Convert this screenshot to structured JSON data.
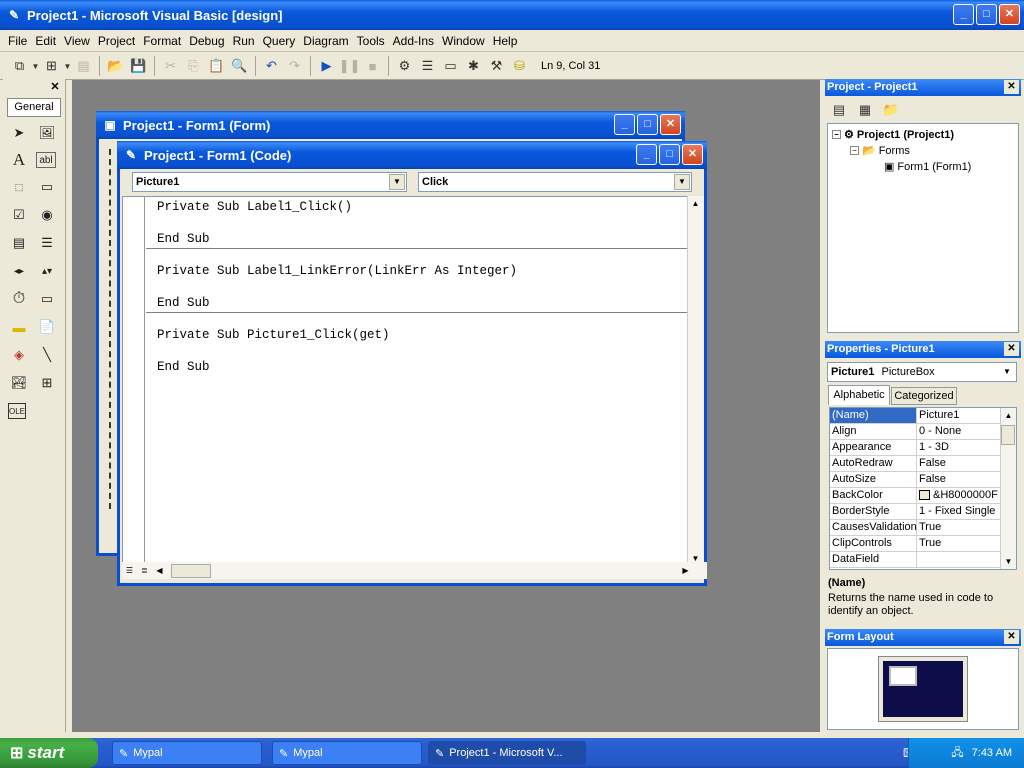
{
  "app": {
    "title": "Project1 - Microsoft Visual Basic [design]"
  },
  "menu": [
    "File",
    "Edit",
    "View",
    "Project",
    "Format",
    "Debug",
    "Run",
    "Query",
    "Diagram",
    "Tools",
    "Add-Ins",
    "Window",
    "Help"
  ],
  "toolbar": {
    "position": "Ln 9, Col 31"
  },
  "toolbox": {
    "tab": "General"
  },
  "form_window": {
    "title": "Project1 - Form1 (Form)"
  },
  "code_window": {
    "title": "Project1 - Form1 (Code)",
    "object_combo": "Picture1",
    "proc_combo": "Click",
    "lines": [
      "Private Sub Label1_Click()",
      "",
      "End Sub",
      "Private Sub Label1_LinkError(LinkErr As Integer)",
      "",
      "End Sub",
      "Private Sub Picture1_Click(get)",
      "",
      "End Sub"
    ]
  },
  "project_panel": {
    "title": "Project - Project1",
    "tree": [
      "Project1 (Project1)",
      "Forms",
      "Form1 (Form1)"
    ]
  },
  "properties_panel": {
    "title": "Properties - Picture1",
    "object": "Picture1",
    "object_type": "PictureBox",
    "tabs": [
      "Alphabetic",
      "Categorized"
    ],
    "rows": [
      {
        "name": "(Name)",
        "value": "Picture1"
      },
      {
        "name": "Align",
        "value": "0 - None"
      },
      {
        "name": "Appearance",
        "value": "1 - 3D"
      },
      {
        "name": "AutoRedraw",
        "value": "False"
      },
      {
        "name": "AutoSize",
        "value": "False"
      },
      {
        "name": "BackColor",
        "value": "&H8000000F"
      },
      {
        "name": "BorderStyle",
        "value": "1 - Fixed Single"
      },
      {
        "name": "CausesValidation",
        "value": "True"
      },
      {
        "name": "ClipControls",
        "value": "True"
      },
      {
        "name": "DataField",
        "value": ""
      }
    ],
    "desc_title": "(Name)",
    "desc_text": "Returns the name used in code to identify an object."
  },
  "form_layout": {
    "title": "Form Layout"
  },
  "taskbar": {
    "start": "start",
    "buttons": [
      "Mypal",
      "Mypal",
      "Project1 - Microsoft V..."
    ],
    "clock": "7:43 AM"
  },
  "colors": {
    "xp_blue": "#0a58dc",
    "mdi_gray": "#808080",
    "selection": "#316ac5"
  }
}
